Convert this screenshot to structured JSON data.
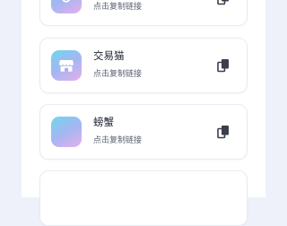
{
  "accent_gradient": [
    "#6fd6ec",
    "#a5b6f2",
    "#e5b0ea"
  ],
  "cards": [
    {
      "name": "",
      "subtitle": "点击复制链接",
      "icon": "refresh-icon",
      "copy_icon": "copy-icon"
    },
    {
      "name": "交易猫",
      "subtitle": "点击复制链接",
      "icon": "store-icon",
      "copy_icon": "copy-icon"
    },
    {
      "name": "螃蟹",
      "subtitle": "点击复制链接",
      "icon": "",
      "copy_icon": "copy-icon"
    }
  ]
}
